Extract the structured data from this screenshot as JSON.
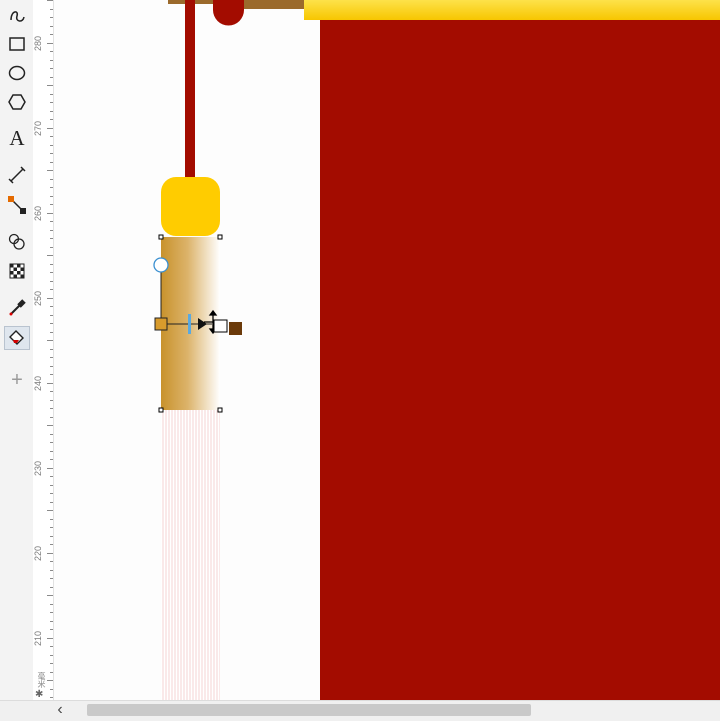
{
  "ruler": {
    "labels": [
      "280",
      "270",
      "260",
      "250",
      "240",
      "230",
      "220",
      "210"
    ],
    "corner_symbol": "✱",
    "unit_label": "毫米"
  },
  "toolbox": {
    "tools": [
      {
        "name": "freehand-tool",
        "icon": "freehand-curve-icon"
      },
      {
        "name": "rectangle-tool",
        "icon": "rectangle-icon"
      },
      {
        "name": "ellipse-tool",
        "icon": "ellipse-icon"
      },
      {
        "name": "polygon-tool",
        "icon": "hexagon-icon"
      },
      {
        "name": "text-tool",
        "icon": "text-a-icon",
        "label": "A"
      },
      {
        "name": "parallel-dimension-tool",
        "icon": "dimension-line-icon"
      },
      {
        "name": "connector-tool",
        "icon": "connector-icon"
      },
      {
        "name": "blend-tool",
        "icon": "blend-circles-icon"
      },
      {
        "name": "transparency-tool",
        "icon": "checkerboard-icon"
      },
      {
        "name": "eyedropper-tool",
        "icon": "eyedropper-icon"
      },
      {
        "name": "interactive-fill-tool",
        "icon": "fill-bucket-icon"
      },
      {
        "name": "add-tool",
        "icon": "plus-icon",
        "label": "+"
      }
    ]
  },
  "colors": {
    "canvas_red": "#a30c00",
    "gold": "#ffcc00",
    "gold_bar": "#fdd500",
    "cord_red": "#a30c00",
    "brown": "#9b6a2c",
    "tassel_gradient_start": "#c8922c",
    "tassel_gradient_end": "#ffffff",
    "fill_node_start": "#d89b2c",
    "fill_node_end": "#6b3a0a",
    "fringe": "#f4c8c8"
  },
  "scrollbar": {
    "left_arrow": "‹"
  }
}
